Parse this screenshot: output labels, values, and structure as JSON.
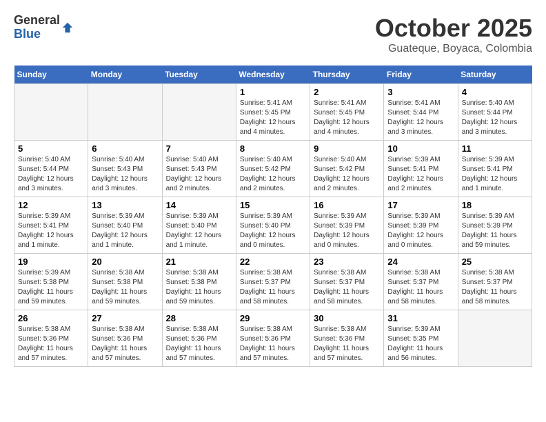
{
  "header": {
    "logo_general": "General",
    "logo_blue": "Blue",
    "month": "October 2025",
    "location": "Guateque, Boyaca, Colombia"
  },
  "days_of_week": [
    "Sunday",
    "Monday",
    "Tuesday",
    "Wednesday",
    "Thursday",
    "Friday",
    "Saturday"
  ],
  "weeks": [
    [
      {
        "day": "",
        "empty": true
      },
      {
        "day": "",
        "empty": true
      },
      {
        "day": "",
        "empty": true
      },
      {
        "day": "1",
        "text": "Sunrise: 5:41 AM\nSunset: 5:45 PM\nDaylight: 12 hours\nand 4 minutes."
      },
      {
        "day": "2",
        "text": "Sunrise: 5:41 AM\nSunset: 5:45 PM\nDaylight: 12 hours\nand 4 minutes."
      },
      {
        "day": "3",
        "text": "Sunrise: 5:41 AM\nSunset: 5:44 PM\nDaylight: 12 hours\nand 3 minutes."
      },
      {
        "day": "4",
        "text": "Sunrise: 5:40 AM\nSunset: 5:44 PM\nDaylight: 12 hours\nand 3 minutes."
      }
    ],
    [
      {
        "day": "5",
        "text": "Sunrise: 5:40 AM\nSunset: 5:44 PM\nDaylight: 12 hours\nand 3 minutes."
      },
      {
        "day": "6",
        "text": "Sunrise: 5:40 AM\nSunset: 5:43 PM\nDaylight: 12 hours\nand 3 minutes."
      },
      {
        "day": "7",
        "text": "Sunrise: 5:40 AM\nSunset: 5:43 PM\nDaylight: 12 hours\nand 2 minutes."
      },
      {
        "day": "8",
        "text": "Sunrise: 5:40 AM\nSunset: 5:42 PM\nDaylight: 12 hours\nand 2 minutes."
      },
      {
        "day": "9",
        "text": "Sunrise: 5:40 AM\nSunset: 5:42 PM\nDaylight: 12 hours\nand 2 minutes."
      },
      {
        "day": "10",
        "text": "Sunrise: 5:39 AM\nSunset: 5:41 PM\nDaylight: 12 hours\nand 2 minutes."
      },
      {
        "day": "11",
        "text": "Sunrise: 5:39 AM\nSunset: 5:41 PM\nDaylight: 12 hours\nand 1 minute."
      }
    ],
    [
      {
        "day": "12",
        "text": "Sunrise: 5:39 AM\nSunset: 5:41 PM\nDaylight: 12 hours\nand 1 minute."
      },
      {
        "day": "13",
        "text": "Sunrise: 5:39 AM\nSunset: 5:40 PM\nDaylight: 12 hours\nand 1 minute."
      },
      {
        "day": "14",
        "text": "Sunrise: 5:39 AM\nSunset: 5:40 PM\nDaylight: 12 hours\nand 1 minute."
      },
      {
        "day": "15",
        "text": "Sunrise: 5:39 AM\nSunset: 5:40 PM\nDaylight: 12 hours\nand 0 minutes."
      },
      {
        "day": "16",
        "text": "Sunrise: 5:39 AM\nSunset: 5:39 PM\nDaylight: 12 hours\nand 0 minutes."
      },
      {
        "day": "17",
        "text": "Sunrise: 5:39 AM\nSunset: 5:39 PM\nDaylight: 12 hours\nand 0 minutes."
      },
      {
        "day": "18",
        "text": "Sunrise: 5:39 AM\nSunset: 5:39 PM\nDaylight: 11 hours\nand 59 minutes."
      }
    ],
    [
      {
        "day": "19",
        "text": "Sunrise: 5:39 AM\nSunset: 5:38 PM\nDaylight: 11 hours\nand 59 minutes."
      },
      {
        "day": "20",
        "text": "Sunrise: 5:38 AM\nSunset: 5:38 PM\nDaylight: 11 hours\nand 59 minutes."
      },
      {
        "day": "21",
        "text": "Sunrise: 5:38 AM\nSunset: 5:38 PM\nDaylight: 11 hours\nand 59 minutes."
      },
      {
        "day": "22",
        "text": "Sunrise: 5:38 AM\nSunset: 5:37 PM\nDaylight: 11 hours\nand 58 minutes."
      },
      {
        "day": "23",
        "text": "Sunrise: 5:38 AM\nSunset: 5:37 PM\nDaylight: 11 hours\nand 58 minutes."
      },
      {
        "day": "24",
        "text": "Sunrise: 5:38 AM\nSunset: 5:37 PM\nDaylight: 11 hours\nand 58 minutes."
      },
      {
        "day": "25",
        "text": "Sunrise: 5:38 AM\nSunset: 5:37 PM\nDaylight: 11 hours\nand 58 minutes."
      }
    ],
    [
      {
        "day": "26",
        "text": "Sunrise: 5:38 AM\nSunset: 5:36 PM\nDaylight: 11 hours\nand 57 minutes."
      },
      {
        "day": "27",
        "text": "Sunrise: 5:38 AM\nSunset: 5:36 PM\nDaylight: 11 hours\nand 57 minutes."
      },
      {
        "day": "28",
        "text": "Sunrise: 5:38 AM\nSunset: 5:36 PM\nDaylight: 11 hours\nand 57 minutes."
      },
      {
        "day": "29",
        "text": "Sunrise: 5:38 AM\nSunset: 5:36 PM\nDaylight: 11 hours\nand 57 minutes."
      },
      {
        "day": "30",
        "text": "Sunrise: 5:38 AM\nSunset: 5:36 PM\nDaylight: 11 hours\nand 57 minutes."
      },
      {
        "day": "31",
        "text": "Sunrise: 5:39 AM\nSunset: 5:35 PM\nDaylight: 11 hours\nand 56 minutes."
      },
      {
        "day": "",
        "empty": true
      }
    ]
  ]
}
